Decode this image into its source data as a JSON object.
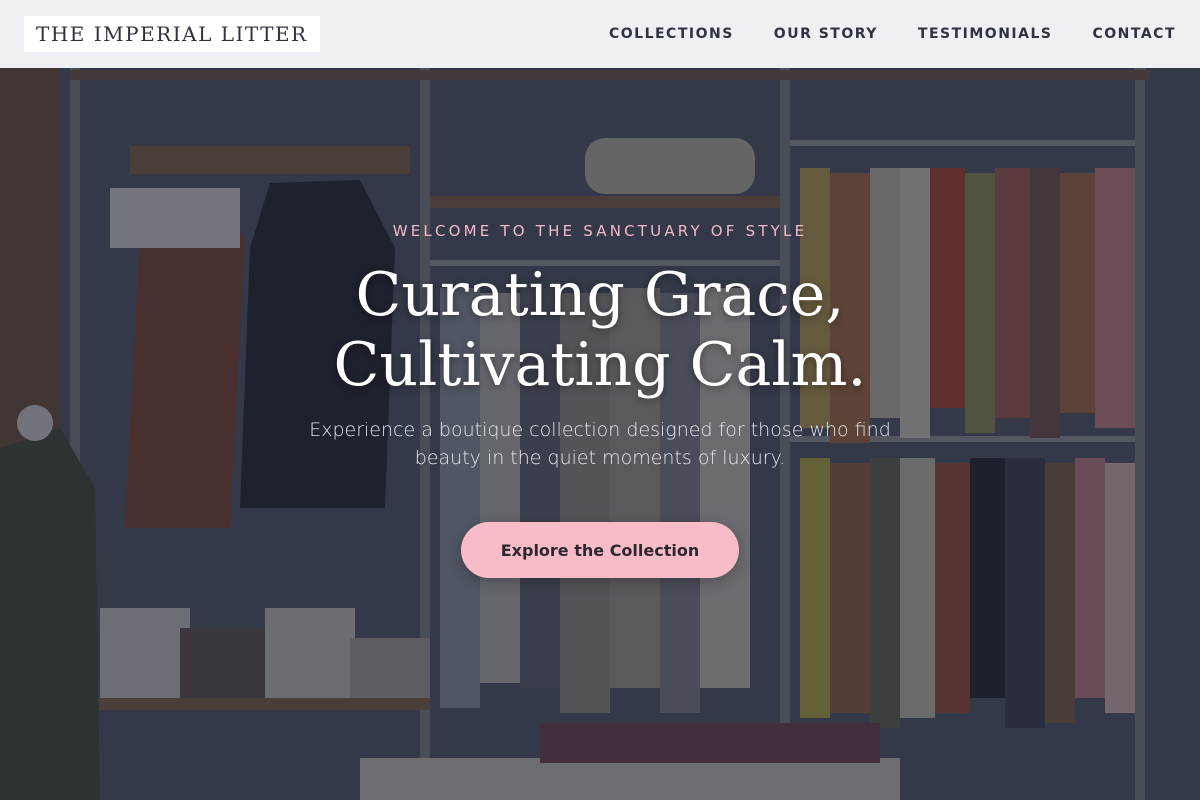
{
  "header": {
    "logo_text": "THE IMPERIAL LITTER",
    "nav": [
      {
        "label": "COLLECTIONS"
      },
      {
        "label": "OUR STORY"
      },
      {
        "label": "TESTIMONIALS"
      },
      {
        "label": "CONTACT"
      }
    ]
  },
  "hero": {
    "eyebrow": "WELCOME TO THE SANCTUARY OF STYLE",
    "headline_line1": "Curating Grace,",
    "headline_line2": "Cultivating Calm.",
    "subtitle": "Experience a boutique collection designed for those who find beauty in the quiet moments of luxury.",
    "cta_label": "Explore the Collection",
    "background_image": "boutique-clothing-rack-photo"
  },
  "colors": {
    "accent_pink": "#f8bcc9",
    "eyebrow_pink": "#f2b9c8",
    "header_bg": "#eef0f3",
    "nav_text": "#2d3340"
  }
}
